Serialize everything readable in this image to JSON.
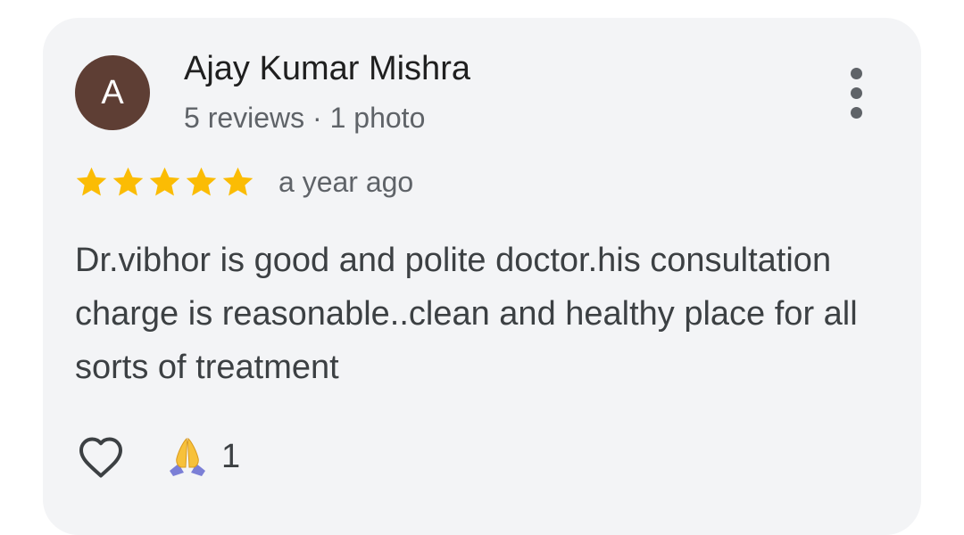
{
  "review": {
    "avatar_letter": "A",
    "avatar_color": "#5e3e34",
    "reviewer_name": "Ajay Kumar Mishra",
    "reviewer_meta": "5 reviews · 1 photo",
    "rating": 5,
    "rating_max": 5,
    "star_color": "#fbbc04",
    "time_ago": "a year ago",
    "text": "Dr.vibhor is good and polite doctor.his consultation charge is reasonable..clean and healthy place for all sorts of treatment",
    "menu_icon": "more-vert-icon",
    "like_icon": "heart-outline-icon",
    "reaction_icon": "folded-hands-emoji",
    "reaction_count": "1"
  }
}
